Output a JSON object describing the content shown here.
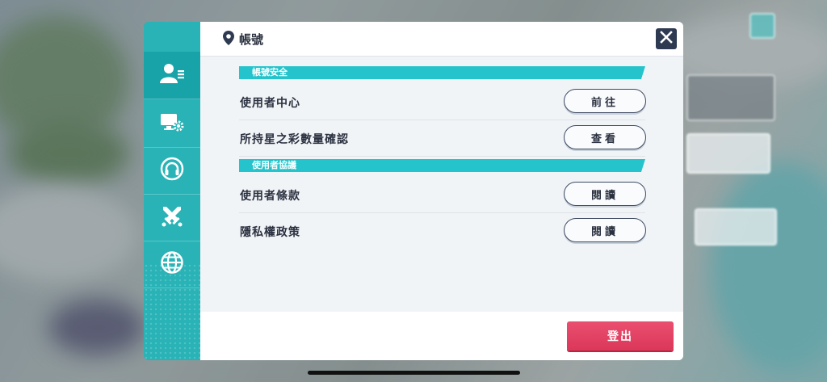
{
  "header": {
    "title": "帳號",
    "pin_icon": "location-pin-icon"
  },
  "close": {
    "icon": "close-icon"
  },
  "tabs": [
    {
      "name": "account-tab",
      "icon": "account-icon",
      "active": true
    },
    {
      "name": "display-settings-tab",
      "icon": "monitor-gear-icon",
      "active": false
    },
    {
      "name": "audio-tab",
      "icon": "headphones-icon",
      "active": false
    },
    {
      "name": "battle-tab",
      "icon": "crossed-swords-icon",
      "active": false
    },
    {
      "name": "language-tab",
      "icon": "globe-icon",
      "active": false
    }
  ],
  "sections": [
    {
      "title": "帳號安全",
      "rows": [
        {
          "label": "使用者中心",
          "button": "前往"
        },
        {
          "label": "所持星之彩數量確認",
          "button": "查看"
        }
      ]
    },
    {
      "title": "使用者協議",
      "rows": [
        {
          "label": "使用者條款",
          "button": "閱讀"
        },
        {
          "label": "隱私權政策",
          "button": "閱讀"
        }
      ]
    }
  ],
  "footer": {
    "logout_label": "登出"
  },
  "colors": {
    "accent": "#29b3b6",
    "section_bar": "#25c4cc",
    "logout": "#e0405f",
    "close_bg": "#2e3a52"
  }
}
